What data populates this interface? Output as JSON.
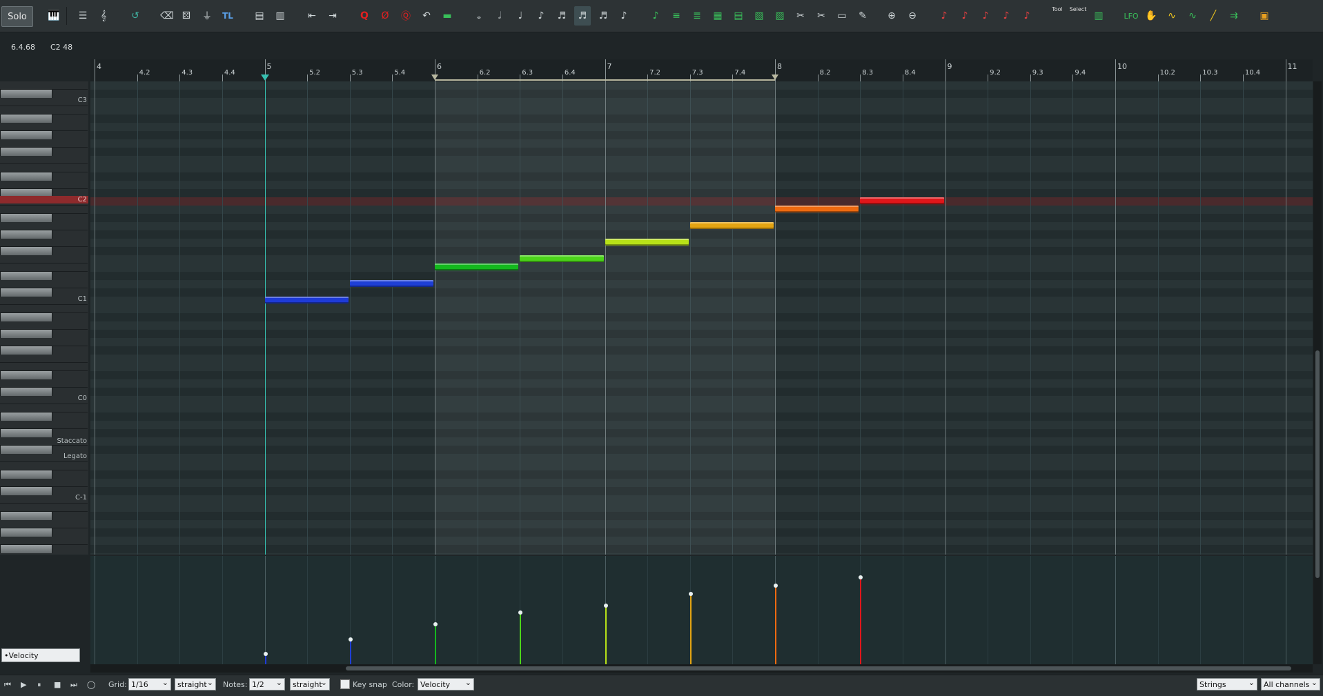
{
  "toolbar": {
    "solo_label": "Solo",
    "tl_label": "TL",
    "tool_label": "Tool",
    "select_label": "Select",
    "lfo_label": "LFO",
    "icons": [
      "piano-keys-icon",
      "list-icon",
      "notation-icon",
      "undo-icon",
      "eraser-icon",
      "dice-icon",
      "filter-icon",
      "move-left-icon",
      "move-right-icon",
      "quantize-icon",
      "dequantize-icon",
      "restore-icon",
      "legato-icon",
      "note-whole-icon",
      "note-half-icon",
      "note-quarter-icon",
      "note-eighth-icon",
      "note-sixteenth-icon",
      "note-32nd-icon",
      "note-64th-icon",
      "note-128th-icon",
      "glue-icon",
      "split-icon",
      "zoom-in-icon",
      "zoom-out-icon",
      "color-icon"
    ]
  },
  "position": {
    "time": "6.4.68",
    "note": "C2 48"
  },
  "ruler": {
    "labels": [
      "4",
      "4.2",
      "4.3",
      "4.4",
      "5",
      "5.2",
      "5.3",
      "5.4",
      "6",
      "6.2",
      "6.3",
      "6.4",
      "7",
      "7.2",
      "7.3",
      "7.4",
      "8",
      "8.2",
      "8.3",
      "8.4",
      "9",
      "9.2",
      "9.3",
      "9.4",
      "10",
      "10.2",
      "10.3",
      "10.4",
      "11"
    ]
  },
  "keyboard": {
    "labels": [
      "C3",
      "C2",
      "C1",
      "C0",
      "Staccato",
      "Legato",
      "C-1"
    ],
    "highlight_key": "C2"
  },
  "notes": [
    {
      "start_bar": 5.0,
      "end_bar": 5.5,
      "pitch": "C1",
      "color": "#1e3bd8",
      "velocity": 12
    },
    {
      "start_bar": 5.5,
      "end_bar": 6.0,
      "pitch": "D1",
      "color": "#1e3fd6",
      "velocity": 30
    },
    {
      "start_bar": 6.0,
      "end_bar": 6.5,
      "pitch": "E1",
      "color": "#14b81e",
      "velocity": 48
    },
    {
      "start_bar": 6.5,
      "end_bar": 7.0,
      "pitch": "F1",
      "color": "#4cd41a",
      "velocity": 62
    },
    {
      "start_bar": 7.0,
      "end_bar": 7.5,
      "pitch": "G1",
      "color": "#b7e218",
      "velocity": 70
    },
    {
      "start_bar": 7.5,
      "end_bar": 8.0,
      "pitch": "A1",
      "color": "#e3a412",
      "velocity": 84
    },
    {
      "start_bar": 8.0,
      "end_bar": 8.5,
      "pitch": "B1",
      "color": "#ee6a10",
      "velocity": 94
    },
    {
      "start_bar": 8.5,
      "end_bar": 9.0,
      "pitch": "C2",
      "color": "#e0161a",
      "velocity": 104
    }
  ],
  "lane": {
    "selector": "•Velocity"
  },
  "bottom": {
    "grid_label": "Grid:",
    "grid_value": "1/16",
    "grid_mode": "straight",
    "notes_label": "Notes:",
    "notes_value": "1/2",
    "notes_mode": "straight",
    "key_snap_label": "Key snap",
    "color_label": "Color:",
    "color_value": "Velocity",
    "instrument": "Strings",
    "channels": "All channels"
  }
}
